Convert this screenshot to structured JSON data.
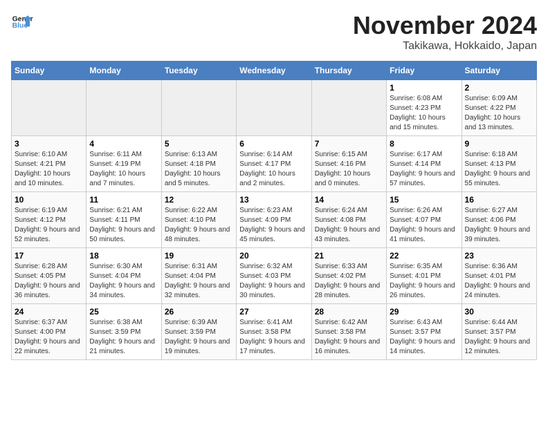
{
  "header": {
    "logo_line1": "General",
    "logo_line2": "Blue",
    "month": "November 2024",
    "location": "Takikawa, Hokkaido, Japan"
  },
  "weekdays": [
    "Sunday",
    "Monday",
    "Tuesday",
    "Wednesday",
    "Thursday",
    "Friday",
    "Saturday"
  ],
  "weeks": [
    [
      {
        "day": "",
        "empty": true
      },
      {
        "day": "",
        "empty": true
      },
      {
        "day": "",
        "empty": true
      },
      {
        "day": "",
        "empty": true
      },
      {
        "day": "",
        "empty": true
      },
      {
        "day": "1",
        "sunrise": "6:08 AM",
        "sunset": "4:23 PM",
        "daylight": "10 hours and 15 minutes."
      },
      {
        "day": "2",
        "sunrise": "6:09 AM",
        "sunset": "4:22 PM",
        "daylight": "10 hours and 13 minutes."
      }
    ],
    [
      {
        "day": "3",
        "sunrise": "6:10 AM",
        "sunset": "4:21 PM",
        "daylight": "10 hours and 10 minutes."
      },
      {
        "day": "4",
        "sunrise": "6:11 AM",
        "sunset": "4:19 PM",
        "daylight": "10 hours and 7 minutes."
      },
      {
        "day": "5",
        "sunrise": "6:13 AM",
        "sunset": "4:18 PM",
        "daylight": "10 hours and 5 minutes."
      },
      {
        "day": "6",
        "sunrise": "6:14 AM",
        "sunset": "4:17 PM",
        "daylight": "10 hours and 2 minutes."
      },
      {
        "day": "7",
        "sunrise": "6:15 AM",
        "sunset": "4:16 PM",
        "daylight": "10 hours and 0 minutes."
      },
      {
        "day": "8",
        "sunrise": "6:17 AM",
        "sunset": "4:14 PM",
        "daylight": "9 hours and 57 minutes."
      },
      {
        "day": "9",
        "sunrise": "6:18 AM",
        "sunset": "4:13 PM",
        "daylight": "9 hours and 55 minutes."
      }
    ],
    [
      {
        "day": "10",
        "sunrise": "6:19 AM",
        "sunset": "4:12 PM",
        "daylight": "9 hours and 52 minutes."
      },
      {
        "day": "11",
        "sunrise": "6:21 AM",
        "sunset": "4:11 PM",
        "daylight": "9 hours and 50 minutes."
      },
      {
        "day": "12",
        "sunrise": "6:22 AM",
        "sunset": "4:10 PM",
        "daylight": "9 hours and 48 minutes."
      },
      {
        "day": "13",
        "sunrise": "6:23 AM",
        "sunset": "4:09 PM",
        "daylight": "9 hours and 45 minutes."
      },
      {
        "day": "14",
        "sunrise": "6:24 AM",
        "sunset": "4:08 PM",
        "daylight": "9 hours and 43 minutes."
      },
      {
        "day": "15",
        "sunrise": "6:26 AM",
        "sunset": "4:07 PM",
        "daylight": "9 hours and 41 minutes."
      },
      {
        "day": "16",
        "sunrise": "6:27 AM",
        "sunset": "4:06 PM",
        "daylight": "9 hours and 39 minutes."
      }
    ],
    [
      {
        "day": "17",
        "sunrise": "6:28 AM",
        "sunset": "4:05 PM",
        "daylight": "9 hours and 36 minutes."
      },
      {
        "day": "18",
        "sunrise": "6:30 AM",
        "sunset": "4:04 PM",
        "daylight": "9 hours and 34 minutes."
      },
      {
        "day": "19",
        "sunrise": "6:31 AM",
        "sunset": "4:04 PM",
        "daylight": "9 hours and 32 minutes."
      },
      {
        "day": "20",
        "sunrise": "6:32 AM",
        "sunset": "4:03 PM",
        "daylight": "9 hours and 30 minutes."
      },
      {
        "day": "21",
        "sunrise": "6:33 AM",
        "sunset": "4:02 PM",
        "daylight": "9 hours and 28 minutes."
      },
      {
        "day": "22",
        "sunrise": "6:35 AM",
        "sunset": "4:01 PM",
        "daylight": "9 hours and 26 minutes."
      },
      {
        "day": "23",
        "sunrise": "6:36 AM",
        "sunset": "4:01 PM",
        "daylight": "9 hours and 24 minutes."
      }
    ],
    [
      {
        "day": "24",
        "sunrise": "6:37 AM",
        "sunset": "4:00 PM",
        "daylight": "9 hours and 22 minutes."
      },
      {
        "day": "25",
        "sunrise": "6:38 AM",
        "sunset": "3:59 PM",
        "daylight": "9 hours and 21 minutes."
      },
      {
        "day": "26",
        "sunrise": "6:39 AM",
        "sunset": "3:59 PM",
        "daylight": "9 hours and 19 minutes."
      },
      {
        "day": "27",
        "sunrise": "6:41 AM",
        "sunset": "3:58 PM",
        "daylight": "9 hours and 17 minutes."
      },
      {
        "day": "28",
        "sunrise": "6:42 AM",
        "sunset": "3:58 PM",
        "daylight": "9 hours and 16 minutes."
      },
      {
        "day": "29",
        "sunrise": "6:43 AM",
        "sunset": "3:57 PM",
        "daylight": "9 hours and 14 minutes."
      },
      {
        "day": "30",
        "sunrise": "6:44 AM",
        "sunset": "3:57 PM",
        "daylight": "9 hours and 12 minutes."
      }
    ]
  ]
}
